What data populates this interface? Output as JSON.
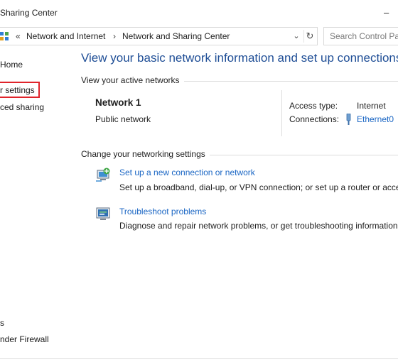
{
  "window": {
    "title": "Sharing Center",
    "minimize_glyph": "–"
  },
  "address": {
    "breadcrumbs": [
      "Network and Internet",
      "Network and Sharing Center"
    ],
    "separator": "›",
    "leading_separator": "«",
    "search_placeholder": "Search Control Pa"
  },
  "sidebar": {
    "items": [
      {
        "label": "Home"
      },
      {
        "label": "r settings"
      },
      {
        "label": "ced sharing"
      }
    ],
    "see_also": [
      {
        "label": "s"
      },
      {
        "label": "nder Firewall"
      }
    ]
  },
  "main": {
    "heading": "View your basic network information and set up connections",
    "active_networks_label": "View your active networks",
    "network": {
      "name": "Network 1",
      "type": "Public network",
      "access_type_label": "Access type:",
      "access_type_value": "Internet",
      "connections_label": "Connections:",
      "connections_value": "Ethernet0"
    },
    "change_settings_label": "Change your networking settings",
    "tasks": [
      {
        "icon": "new-connection-icon",
        "title": "Set up a new connection or network",
        "description": "Set up a broadband, dial-up, or VPN connection; or set up a router or access"
      },
      {
        "icon": "troubleshoot-icon",
        "title": "Troubleshoot problems",
        "description": "Diagnose and repair network problems, or get troubleshooting information"
      }
    ]
  },
  "colors": {
    "heading": "#1f4e96",
    "link": "#1a66c4",
    "focus_outline": "#e0242b"
  }
}
